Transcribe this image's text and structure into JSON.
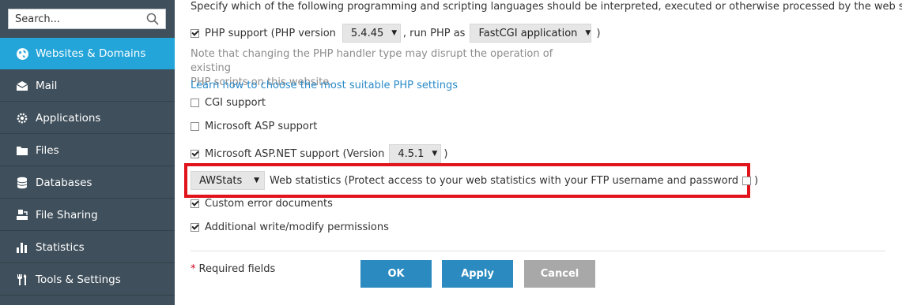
{
  "sidebar": {
    "search_placeholder": "Search...",
    "items": [
      {
        "label": "Websites & Domains",
        "icon": "globe-icon"
      },
      {
        "label": "Mail",
        "icon": "envelope-icon"
      },
      {
        "label": "Applications",
        "icon": "gear-icon"
      },
      {
        "label": "Files",
        "icon": "folder-icon"
      },
      {
        "label": "Databases",
        "icon": "database-icon"
      },
      {
        "label": "File Sharing",
        "icon": "file-sharing-icon"
      },
      {
        "label": "Statistics",
        "icon": "bar-chart-icon"
      },
      {
        "label": "Tools & Settings",
        "icon": "tools-icon"
      }
    ]
  },
  "main": {
    "intro": "Specify which of the following programming and scripting languages should be interpreted, executed or otherwise processed by the web server.",
    "php": {
      "label_before": "PHP support (PHP version",
      "version": "5.4.45",
      "label_middle": ", run PHP as",
      "handler": "FastCGI application",
      "label_after": ")",
      "checked": true
    },
    "note_line1": "Note that changing the PHP handler type may disrupt the operation of existing",
    "note_line2": "PHP scripts on this website.",
    "learn_link": "Learn how to choose the most suitable PHP settings",
    "cgi": {
      "label": "CGI support",
      "checked": false
    },
    "asp": {
      "label": "Microsoft ASP support",
      "checked": false
    },
    "aspnet": {
      "label_before": "Microsoft ASP.NET support (Version",
      "version": "4.5.1",
      "label_after": ")",
      "checked": true
    },
    "stats": {
      "tool": "AWStats",
      "label": "Web statistics (Protect access to your web statistics with your FTP username and password",
      "label_after": ")",
      "checked": false
    },
    "custom_errors": {
      "label": "Custom error documents",
      "checked": true
    },
    "write_modify": {
      "label": "Additional write/modify permissions",
      "checked": true
    },
    "required_star": "*",
    "required_text": "Required fields",
    "buttons": {
      "ok": "OK",
      "apply": "Apply",
      "cancel": "Cancel"
    }
  },
  "colors": {
    "sidebar_bg": "#3f4f5b",
    "active": "#23a5d9",
    "primary_button": "#2b8bc1",
    "cancel_button": "#a8a8a8",
    "highlight_border": "#e1131b",
    "link": "#2a8bc9"
  }
}
